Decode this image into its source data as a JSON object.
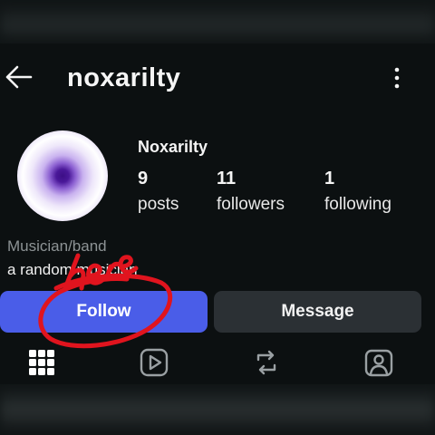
{
  "header": {
    "back_icon": "arrow-left-icon",
    "username": "noxarilty",
    "menu_icon": "vertical-dots-icon"
  },
  "profile": {
    "display_name": "Noxarilty",
    "avatar": "gradient-ring-avatar",
    "stats": [
      {
        "value": "9",
        "label": "posts"
      },
      {
        "value": "11",
        "label": "followers"
      },
      {
        "value": "1",
        "label": "following"
      }
    ],
    "category": "Musician/band",
    "bio": "a random musician"
  },
  "actions": {
    "follow_label": "Follow",
    "message_label": "Message"
  },
  "tabs": [
    {
      "icon": "grid-icon",
      "active": true
    },
    {
      "icon": "reels-play-icon",
      "active": false
    },
    {
      "icon": "repost-icon",
      "active": false
    },
    {
      "icon": "tagged-person-icon",
      "active": false
    }
  ],
  "annotation": {
    "handwritten_text": "here",
    "color": "#e0141e"
  },
  "colors": {
    "background": "#0c1011",
    "follow_button": "#4a5de8",
    "message_button": "#2b3034",
    "muted_text": "#8d9395"
  }
}
